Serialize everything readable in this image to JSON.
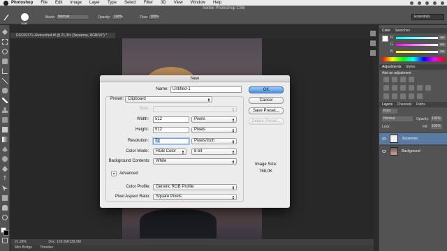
{
  "menubar": {
    "app": "Photoshop",
    "menus": [
      "File",
      "Edit",
      "Image",
      "Layer",
      "Type",
      "Select",
      "Filter",
      "3D",
      "View",
      "Window",
      "Help"
    ]
  },
  "options": {
    "app_title": "Adobe Photoshop CS6",
    "brush_size": "1000",
    "mode_label": "Mode:",
    "mode_value": "Normal",
    "opacity_label": "Opacity:",
    "opacity_value": "100%",
    "flow_label": "Flow:",
    "flow_value": "100%",
    "workspace": "Essentials"
  },
  "document": {
    "tab": "DSC00371–Retouched.tif @ 21,3% (Засветка, RGB/16*) *",
    "zoom": "21,28%",
    "doc_info": "Doc: 139,5M/139,5M",
    "bottom_tabs": [
      "Mini Bridge",
      "Timeline"
    ]
  },
  "color_panel": {
    "tabs": [
      "Color",
      "Swatches"
    ],
    "sliders": [
      {
        "label": "R",
        "value": "255"
      },
      {
        "label": "G",
        "value": "255"
      },
      {
        "label": "B",
        "value": "255"
      }
    ]
  },
  "adjustments_panel": {
    "tabs": [
      "Adjustments",
      "Styles"
    ],
    "heading": "Add an adjustment"
  },
  "layers_panel": {
    "tabs": [
      "Layers",
      "Channels",
      "Paths"
    ],
    "kind": "Kind",
    "blend_mode": "Normal",
    "opacity_label": "Opacity:",
    "opacity_value": "100%",
    "lock_label": "Lock:",
    "fill_label": "Fill:",
    "fill_value": "100%",
    "layers": [
      {
        "name": "Засветка"
      },
      {
        "name": "Background"
      }
    ]
  },
  "dialog": {
    "title": "New",
    "name_label": "Name:",
    "name_value": "Untitled-1",
    "preset_label": "Preset:",
    "preset_value": "Clipboard",
    "size_label": "Size:",
    "width_label": "Width:",
    "width_value": "512",
    "width_unit": "Pixels",
    "height_label": "Height:",
    "height_value": "512",
    "height_unit": "Pixels",
    "resolution_label": "Resolution:",
    "resolution_value": "72",
    "resolution_unit": "Pixels/Inch",
    "color_mode_label": "Color Mode:",
    "color_mode_value": "RGB Color",
    "bit_depth": "8 bit",
    "background_label": "Background Contents:",
    "background_value": "White",
    "advanced_label": "Advanced",
    "profile_label": "Color Profile:",
    "profile_value": "Generic RGB Profile",
    "pixel_aspect_label": "Pixel Aspect Ratio:",
    "pixel_aspect_value": "Square Pixels",
    "image_size_label": "Image Size:",
    "image_size_value": "768,0K",
    "ok": "OK",
    "cancel": "Cancel",
    "save_preset": "Save Preset...",
    "delete_preset": "Delete Preset..."
  }
}
